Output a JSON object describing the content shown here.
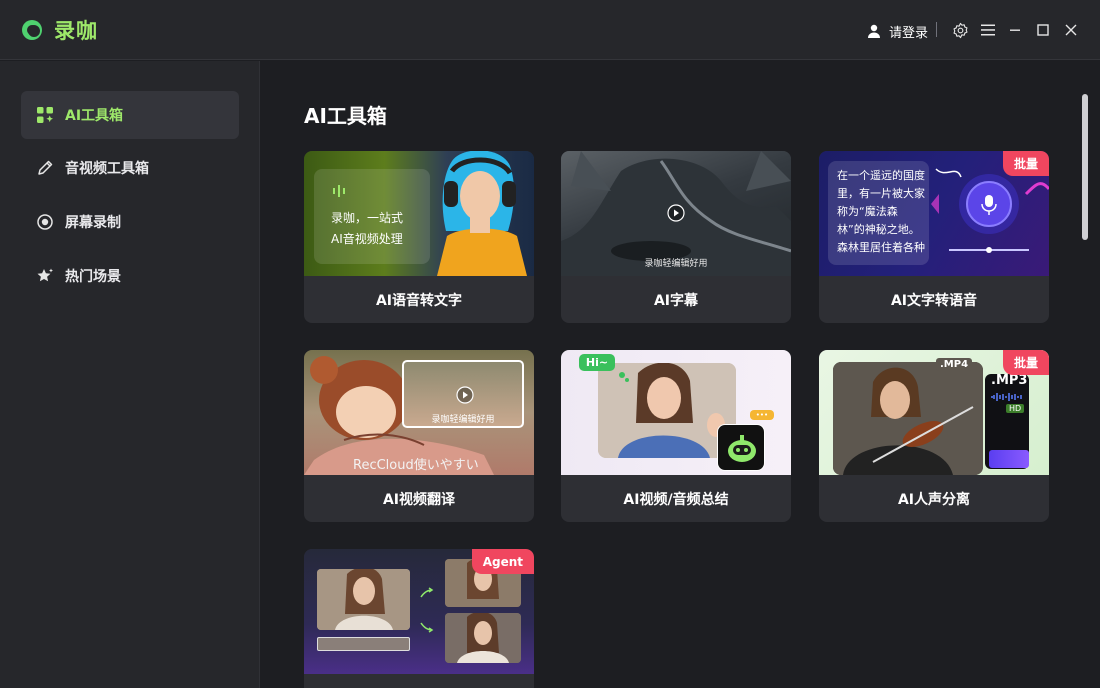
{
  "app": {
    "name": "录咖"
  },
  "titlebar": {
    "login_label": "请登录"
  },
  "sidebar": {
    "items": [
      {
        "label": "AI工具箱",
        "icon": "grid-sparkle-icon",
        "active": true
      },
      {
        "label": "音视频工具箱",
        "icon": "pencil-icon",
        "active": false
      },
      {
        "label": "屏幕录制",
        "icon": "record-icon",
        "active": false
      },
      {
        "label": "热门场景",
        "icon": "star-icon",
        "active": false
      }
    ]
  },
  "main": {
    "title": "AI工具箱",
    "cards": [
      {
        "label": "AI语音转文字",
        "overlay_line1": "录咖，一站式",
        "overlay_line2": "AI音视频处理"
      },
      {
        "label": "AI字幕",
        "caption": "录咖轻编辑好用"
      },
      {
        "label": "AI文字转语音",
        "badge": "批量",
        "overlay_text": "在一个遥远的国度里，有一片被大家称为“魔法森林”的神秘之地。森林里居住着各种各样的..."
      },
      {
        "label": "AI视频翻译",
        "caption": "录咖轻编辑好用",
        "subtitle": "RecCloud使いやすい"
      },
      {
        "label": "AI视频/音频总结",
        "bubble": "Hi~",
        "dots": "•••"
      },
      {
        "label": "AI人声分离",
        "badge": "批量",
        "tag_mp4": ".MP4",
        "tag_mp3": ".MP3",
        "tag_hd": "HD"
      },
      {
        "label": "",
        "badge": "Agent"
      }
    ]
  },
  "colors": {
    "accent": "#9ee86a",
    "badge": "#f0465f",
    "card_bg": "#2e2f34",
    "sidebar_bg": "#26272b"
  }
}
